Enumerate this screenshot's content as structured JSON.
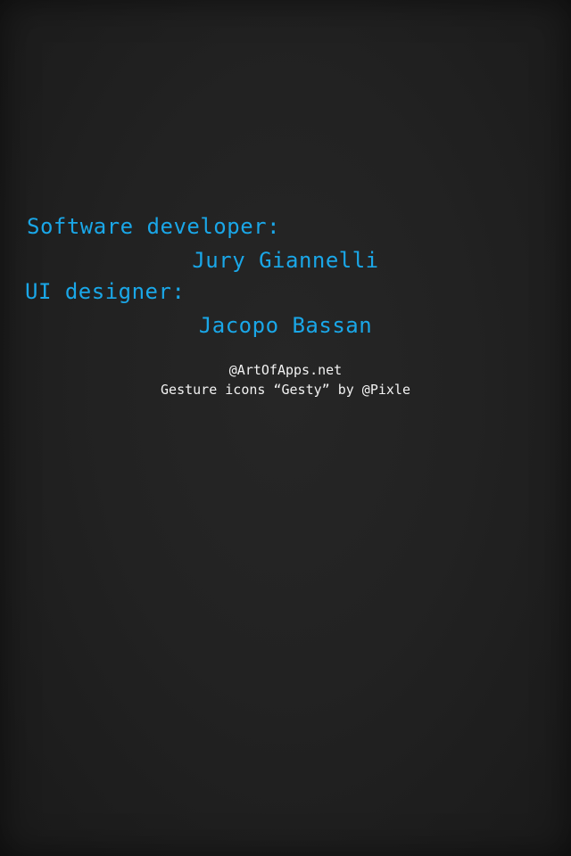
{
  "credits": {
    "software_role": "Software developer:",
    "software_name": "Jury Giannelli",
    "ui_role": "UI designer:",
    "ui_name": "Jacopo Bassan"
  },
  "footer": {
    "website": "@ArtOfApps.net",
    "icons_credit": "Gesture icons “Gesty” by @Pixle"
  },
  "colors": {
    "background": "#222222",
    "accent": "#1aa7e8",
    "small_text": "#f2f2f2"
  }
}
